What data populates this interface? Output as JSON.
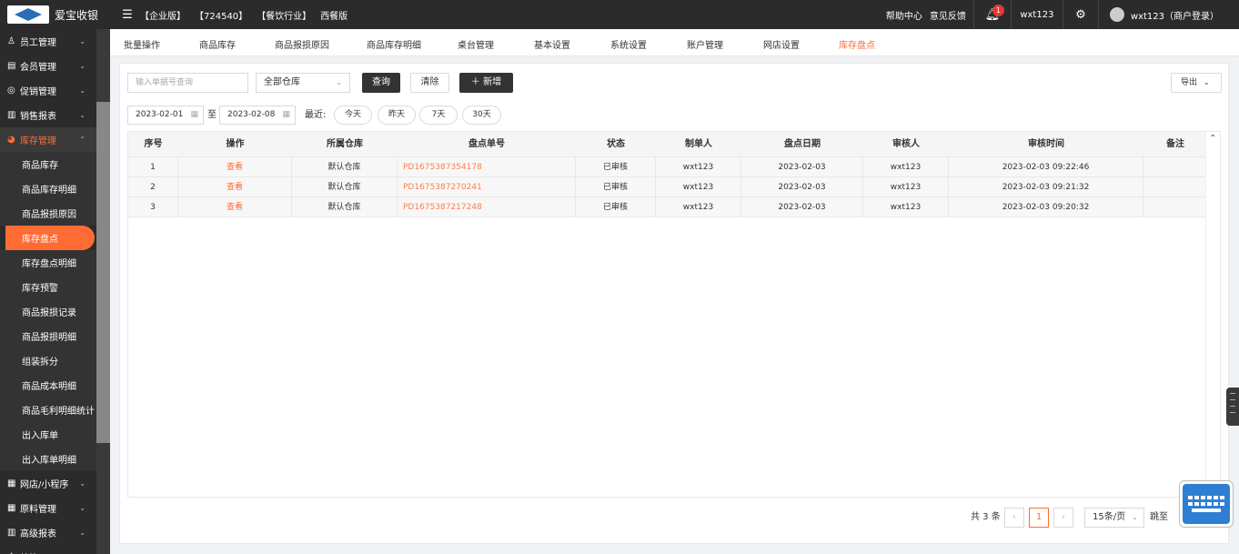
{
  "header": {
    "brand": "爱宝收银",
    "menu_icon": "menu-icon",
    "edition": "【企业版】",
    "store_id": "【724540】",
    "industry": "【餐饮行业】",
    "version": "西餐版",
    "help": "帮助中心",
    "feedback": "意见反馈",
    "notifications_count": "1",
    "user_short": "wxt123",
    "user_full": "wxt123（商户登录）"
  },
  "sidebar": {
    "groups_top": [
      {
        "label": "员工管理",
        "icon": "user-icon",
        "glyph": "♙"
      },
      {
        "label": "会员管理",
        "icon": "member-icon",
        "glyph": "▤"
      },
      {
        "label": "促销管理",
        "icon": "promo-icon",
        "glyph": "◎"
      },
      {
        "label": "销售报表",
        "icon": "chart-icon",
        "glyph": "▥"
      }
    ],
    "active_group": {
      "label": "库存管理",
      "icon": "pie-icon",
      "glyph": "◕"
    },
    "sub_items": [
      "商品库存",
      "商品库存明细",
      "商品报损原因",
      "库存盘点",
      "库存盘点明细",
      "库存预警",
      "商品报损记录",
      "商品报损明细",
      "组装拆分",
      "商品成本明细",
      "商品毛利明细统计",
      "出入库单",
      "出入库单明细"
    ],
    "current_sub": "库存盘点",
    "groups_bottom": [
      {
        "label": "网店/小程序",
        "icon": "shop-icon",
        "glyph": "▦"
      },
      {
        "label": "原料管理",
        "icon": "material-icon",
        "glyph": "▦"
      },
      {
        "label": "高级报表",
        "icon": "report-icon",
        "glyph": "▥"
      },
      {
        "label": "结算",
        "icon": "settle-icon",
        "glyph": "♙"
      }
    ]
  },
  "tabs": [
    "批量操作",
    "商品库存",
    "商品报损原因",
    "商品库存明细",
    "桌台管理",
    "基本设置",
    "系统设置",
    "账户管理",
    "网店设置",
    "库存盘点"
  ],
  "active_tab": "库存盘点",
  "filters": {
    "search_placeholder": "输入单据号查询",
    "warehouse": "全部仓库",
    "query_btn": "查询",
    "clear_btn": "清除",
    "add_btn": "＋ 新增",
    "export_btn": "导出",
    "date_from": "2023-02-01",
    "date_to_label": "至",
    "date_to": "2023-02-08",
    "recent_label": "最近:",
    "quick_ranges": [
      "今天",
      "昨天",
      "7天",
      "30天"
    ]
  },
  "table": {
    "columns": [
      "序号",
      "操作",
      "所属仓库",
      "盘点单号",
      "状态",
      "制单人",
      "盘点日期",
      "审核人",
      "审核时间",
      "备注"
    ],
    "rows": [
      [
        "1",
        "查看",
        "默认仓库",
        "PD1675387354178",
        "已审核",
        "wxt123",
        "2023-02-03",
        "wxt123",
        "2023-02-03 09:22:46",
        ""
      ],
      [
        "2",
        "查看",
        "默认仓库",
        "PD1675387270241",
        "已审核",
        "wxt123",
        "2023-02-03",
        "wxt123",
        "2023-02-03 09:21:32",
        ""
      ],
      [
        "3",
        "查看",
        "默认仓库",
        "PD1675387217248",
        "已审核",
        "wxt123",
        "2023-02-03",
        "wxt123",
        "2023-02-03 09:20:32",
        ""
      ]
    ]
  },
  "pagination": {
    "total": "共 3 条",
    "current_page": "1",
    "page_size": "15条/页",
    "jump_label": "跳至"
  },
  "colors": {
    "accent": "#ff6b35",
    "dark": "#2b2b2b"
  }
}
